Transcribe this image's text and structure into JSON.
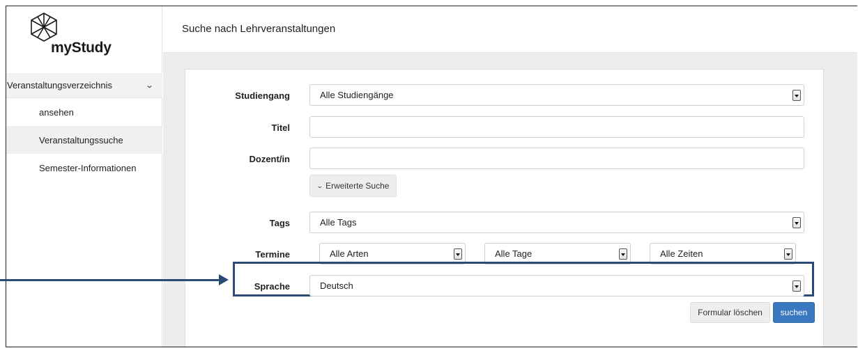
{
  "app": {
    "name": "myStudy"
  },
  "sidebar": {
    "parent": {
      "label": "Veranstaltungsverzeichnis",
      "icon": "chevron-down-icon"
    },
    "items": [
      {
        "label": "ansehen"
      },
      {
        "label": "Veranstaltungssuche",
        "active": true
      },
      {
        "label": "Semester-Informationen"
      }
    ]
  },
  "header": {
    "title": "Suche nach Lehrveranstaltungen"
  },
  "form": {
    "studiengang": {
      "label": "Studiengang",
      "value": "Alle Studiengänge"
    },
    "titel": {
      "label": "Titel",
      "value": ""
    },
    "dozent": {
      "label": "Dozent/in",
      "value": ""
    },
    "advanced_button": "Erweiterte Suche",
    "tags": {
      "label": "Tags",
      "value": "Alle Tags"
    },
    "termine": {
      "label": "Termine",
      "arten": "Alle Arten",
      "tage": "Alle Tage",
      "zeiten": "Alle Zeiten"
    },
    "sprache": {
      "label": "Sprache",
      "value": "Deutsch"
    },
    "clear_button": "Formular löschen",
    "search_button": "suchen"
  },
  "colors": {
    "accent": "#3a79bf",
    "annotation": "#2c4a76"
  }
}
